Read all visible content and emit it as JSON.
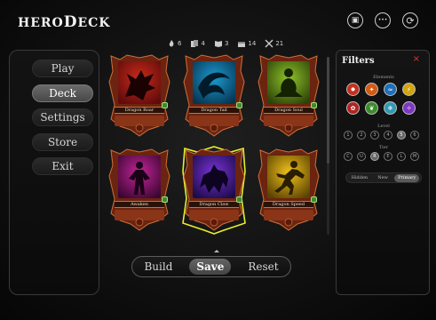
{
  "header": {
    "logo_small_1": "HERO",
    "logo_big": "D",
    "logo_small_2": "ECK",
    "icons": [
      "card-collection-icon",
      "more-icon",
      "refresh-icon"
    ],
    "icon_glyphs": [
      "▣",
      "•••",
      "⟳"
    ]
  },
  "stats": [
    {
      "icon": "flame-icon",
      "value": "6"
    },
    {
      "icon": "cards-icon",
      "value": "4"
    },
    {
      "icon": "book-icon",
      "value": "3"
    },
    {
      "icon": "chest-icon",
      "value": "14"
    },
    {
      "icon": "crossed-swords-icon",
      "value": "21"
    }
  ],
  "nav": {
    "items": [
      {
        "label": "Play"
      },
      {
        "label": "Deck",
        "active": true
      },
      {
        "label": "Settings"
      },
      {
        "label": "Store"
      },
      {
        "label": "Exit"
      }
    ]
  },
  "cards": [
    {
      "name": "Dragon Roar",
      "art": "dragon-head",
      "colors": [
        "#5e0b0b",
        "#c92a1a"
      ]
    },
    {
      "name": "Dragon Tail",
      "art": "dragon-tail",
      "colors": [
        "#063450",
        "#1b9bd1"
      ]
    },
    {
      "name": "Dragon Soul",
      "art": "meditating-figure",
      "colors": [
        "#2c4207",
        "#8fc22a"
      ]
    },
    {
      "name": "Awaken",
      "art": "warrior",
      "colors": [
        "#3b0630",
        "#c2249a"
      ]
    },
    {
      "name": "Dragon Claw",
      "art": "wolf",
      "colors": [
        "#1c0b4a",
        "#7a33d6"
      ],
      "selected": true
    },
    {
      "name": "Dragon Speed",
      "art": "runner",
      "colors": [
        "#5a4203",
        "#f0c21a"
      ]
    }
  ],
  "bottom_bar": {
    "buttons": [
      {
        "label": "Build"
      },
      {
        "label": "Save",
        "active": true
      },
      {
        "label": "Reset"
      }
    ]
  },
  "filters": {
    "title": "Filters",
    "close": "×",
    "elements_label": "Elements",
    "elements": [
      {
        "icon": "fire-icon",
        "glyph": "✹",
        "color": "#c4301e"
      },
      {
        "icon": "flame-icon",
        "glyph": "✦",
        "color": "#d35b14"
      },
      {
        "icon": "water-icon",
        "glyph": "≈",
        "color": "#1f6fb8"
      },
      {
        "icon": "lightning-icon",
        "glyph": "⚡",
        "color": "#d2a510"
      },
      {
        "icon": "nature-icon",
        "glyph": "✿",
        "color": "#b22323"
      },
      {
        "icon": "leaf-icon",
        "glyph": "❦",
        "color": "#3b8d2b"
      },
      {
        "icon": "ice-icon",
        "glyph": "❄",
        "color": "#2f9ab5"
      },
      {
        "icon": "arcane-icon",
        "glyph": "✧",
        "color": "#7e38c2"
      }
    ],
    "level_label": "Level",
    "levels": [
      {
        "label": "1"
      },
      {
        "label": "2"
      },
      {
        "label": "3"
      },
      {
        "label": "4"
      },
      {
        "label": "5",
        "on": true
      },
      {
        "label": "6"
      }
    ],
    "tier_label": "Tier",
    "tiers": [
      {
        "label": "C"
      },
      {
        "label": "U"
      },
      {
        "label": "R",
        "on": true
      },
      {
        "label": "E"
      },
      {
        "label": "L"
      },
      {
        "label": "M"
      }
    ],
    "modes": [
      {
        "label": "Hidden"
      },
      {
        "label": "New"
      },
      {
        "label": "Primary",
        "on": true
      }
    ]
  }
}
